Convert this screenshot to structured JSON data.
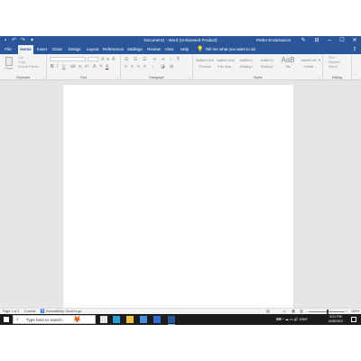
{
  "titlebar": {
    "title": "Document1 - Word (Unlicensed Product)",
    "user": "Pedro Encarnacion",
    "quick_access_icons": [
      "save-icon",
      "undo-icon",
      "redo-icon",
      "customize-icon"
    ],
    "controls": {
      "minimize": "─",
      "maximize": "☐",
      "close": "✕"
    },
    "glyphs": {
      "save": "▪",
      "undo": "↶",
      "redo": "↷",
      "customize": "▾",
      "ribbon_display": "⊟",
      "pen": "✎"
    }
  },
  "menu": {
    "tabs": [
      "File",
      "Home",
      "Insert",
      "Draw",
      "Design",
      "Layout",
      "References",
      "Mailings",
      "Review",
      "View",
      "Help"
    ],
    "active_tab": "Home",
    "tell_me": "Tell me what you want to do",
    "tell_me_icon": "💡",
    "share_icon": "⇪"
  },
  "ribbon": {
    "clipboard": {
      "label": "Clipboard",
      "paste": "Paste",
      "cut": "Cut",
      "copy": "Copy",
      "format_painter": "Format Painter"
    },
    "font": {
      "label": "Font",
      "bold": "B",
      "italic": "I",
      "underline": "U"
    },
    "paragraph": {
      "label": "Paragraph"
    },
    "styles": {
      "label": "Styles",
      "items": [
        {
          "sample": "AaBbCcDd",
          "name": "¶ Normal"
        },
        {
          "sample": "AaBbCcDd",
          "name": "¶ No Spac..."
        },
        {
          "sample": "AaBbCc",
          "name": "Heading 1"
        },
        {
          "sample": "AaBbCc",
          "name": "Heading 2"
        },
        {
          "sample": "AaB",
          "name": "Title"
        },
        {
          "sample": "AaBbCcD",
          "name": "Subtitle"
        }
      ]
    },
    "editing": {
      "label": "Editing",
      "find": "Find",
      "replace": "Replace",
      "select": "Select"
    }
  },
  "statusbar": {
    "page": "Page 1 of 1",
    "words": "0 words",
    "accessibility": "Accessibility: Good to go",
    "zoom": "100%",
    "zoom_minus": "–",
    "zoom_plus": "+",
    "glyphs": {
      "accessibility": "♿",
      "proofing": "▤",
      "read_mode": "▭",
      "print_layout": "▦",
      "web_layout": "▥"
    }
  },
  "taskbar": {
    "search_placeholder": "Type here to search",
    "search_glyph": "⌕",
    "doodle_glyph": "🦊",
    "apps": [
      "task-view",
      "edge",
      "file-explorer",
      "store",
      "mail",
      "word"
    ],
    "app_colors": {
      "task-view": "#e5e5e5",
      "edge": "#2d9bd6",
      "file-explorer": "#f0c043",
      "store": "#4a8fe0",
      "mail": "#2f6fd1",
      "word": "#2b579a"
    },
    "tray": "⌨  ^ ☁ ▭ 🔊 ENG",
    "time": "6:21 PM",
    "date": "6/28/2023"
  },
  "colors": {
    "word_blue": "#2b579a",
    "ribbon_bg": "#f3f3f3",
    "canvas_bg": "#e6e6e6",
    "taskbar_bg": "#1c1c1c"
  }
}
